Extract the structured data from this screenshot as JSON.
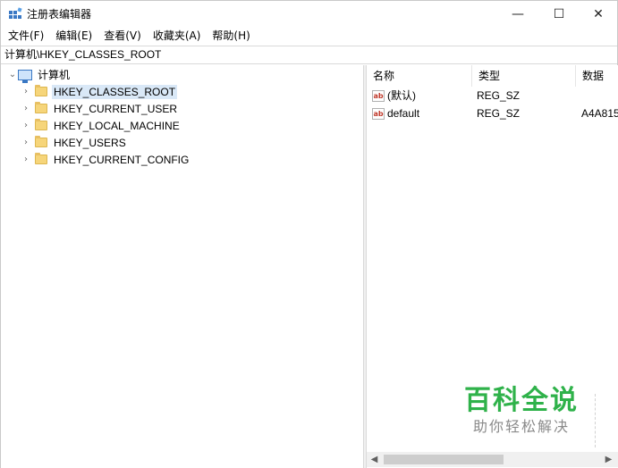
{
  "window": {
    "title": "注册表编辑器",
    "icons": {
      "app": "regedit-icon",
      "minimize": "minimize-icon",
      "maximize": "maximize-icon",
      "close": "close-icon"
    },
    "controls": {
      "minimize": "—",
      "maximize": "☐",
      "close": "✕"
    }
  },
  "menu": {
    "items": [
      "文件(F)",
      "编辑(E)",
      "查看(V)",
      "收藏夹(A)",
      "帮助(H)"
    ]
  },
  "address": {
    "path": "计算机\\HKEY_CLASSES_ROOT"
  },
  "tree": {
    "root": {
      "label": "计算机",
      "icon": "computer-icon",
      "expanded": true
    },
    "keys": [
      {
        "label": "HKEY_CLASSES_ROOT",
        "selected": true
      },
      {
        "label": "HKEY_CURRENT_USER",
        "selected": false
      },
      {
        "label": "HKEY_LOCAL_MACHINE",
        "selected": false
      },
      {
        "label": "HKEY_USERS",
        "selected": false
      },
      {
        "label": "HKEY_CURRENT_CONFIG",
        "selected": false
      }
    ]
  },
  "list": {
    "columns": [
      "名称",
      "类型",
      "数据"
    ],
    "rows": [
      {
        "name": "(默认)",
        "type": "REG_SZ",
        "data": ""
      },
      {
        "name": "default",
        "type": "REG_SZ",
        "data": "A4A815"
      }
    ]
  },
  "watermark": {
    "main": "百科全说",
    "sub": "助你轻松解决"
  },
  "colors": {
    "selection": "#d9e8f7",
    "watermark_green": "#2fb24a",
    "folder": "#f6d57a"
  }
}
